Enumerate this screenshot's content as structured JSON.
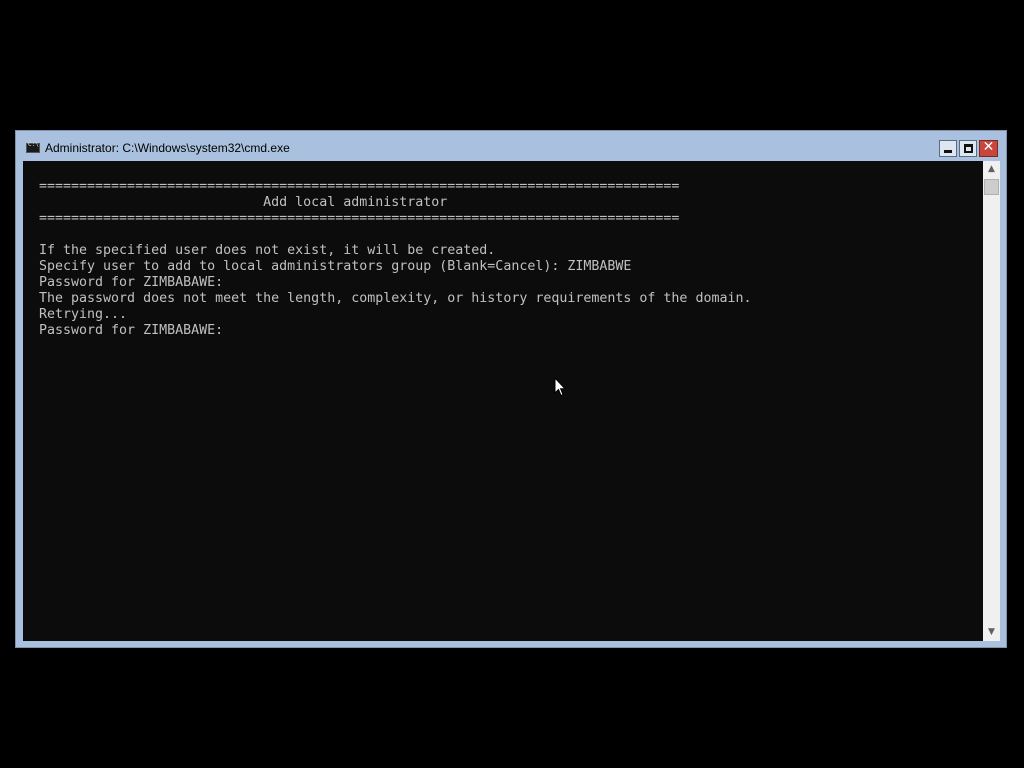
{
  "window": {
    "title": "Administrator: C:\\Windows\\system32\\cmd.exe"
  },
  "console": {
    "lines": [
      "================================================================================",
      "                            Add local administrator",
      "================================================================================",
      "",
      "If the specified user does not exist, it will be created.",
      "Specify user to add to local administrators group (Blank=Cancel): ZIMBABWE",
      "Password for ZIMBABAWE:",
      "The password does not meet the length, complexity, or history requirements of the domain.",
      "Retrying...",
      "Password for ZIMBABAWE:"
    ]
  },
  "controls": {
    "minimize_icon": "minimize-icon",
    "maximize_icon": "maximize-icon",
    "close_icon": "close-icon",
    "close_glyph": "✕"
  },
  "scrollbar": {
    "up_glyph": "▲",
    "down_glyph": "▼"
  },
  "colors": {
    "console_bg": "#0c0c0c",
    "console_fg": "#c0c0c0",
    "frame": "#a9c1de",
    "close_button": "#c9463d"
  }
}
